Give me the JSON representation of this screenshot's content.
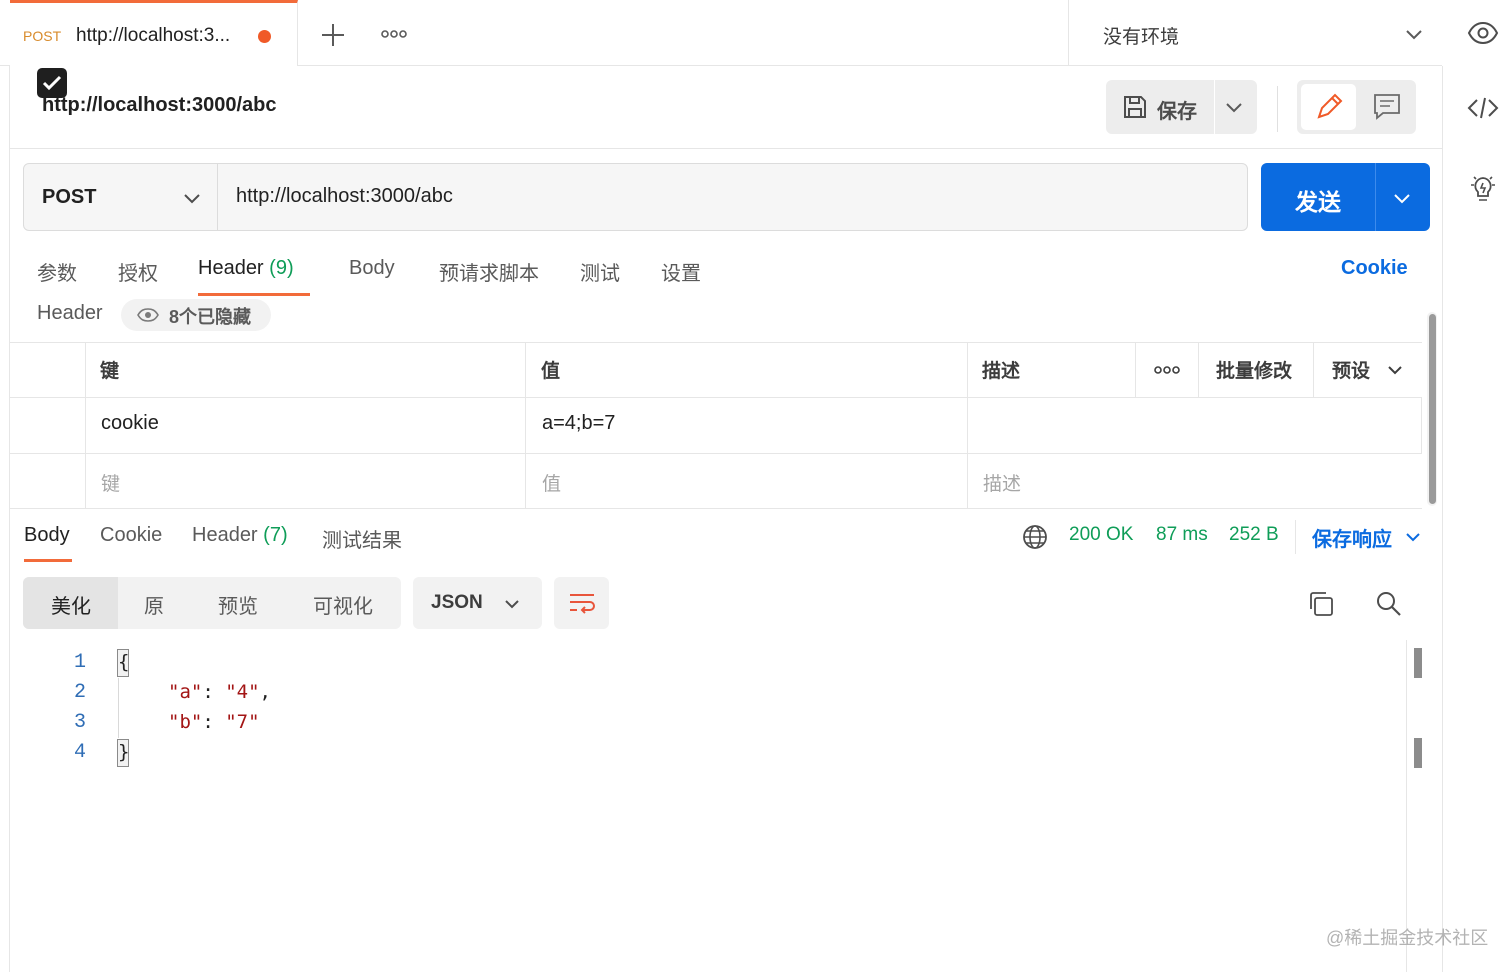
{
  "tab": {
    "method": "POST",
    "title": "http://localhost:3...",
    "unsaved_color": "#f05a28"
  },
  "environment": {
    "label": "没有环境"
  },
  "request": {
    "title": "http://localhost:3000/abc",
    "save_label": "保存",
    "method": "POST",
    "url": "http://localhost:3000/abc",
    "send_label": "发送"
  },
  "request_tabs": [
    {
      "label": "参数"
    },
    {
      "label": "授权"
    },
    {
      "label": "Header",
      "count": "(9)"
    },
    {
      "label": "Body"
    },
    {
      "label": "预请求脚本"
    },
    {
      "label": "测试"
    },
    {
      "label": "设置"
    }
  ],
  "cookie_link": "Cookie",
  "headers_section": {
    "label": "Header",
    "hidden_label": "8个已隐藏",
    "columns": {
      "key": "键",
      "value": "值",
      "description": "描述",
      "bulk_edit": "批量修改",
      "presets": "预设"
    },
    "rows": [
      {
        "checked": true,
        "key": "cookie",
        "value": "a=4;b=7",
        "description": ""
      }
    ],
    "placeholders": {
      "key": "键",
      "value": "值",
      "description": "描述"
    }
  },
  "response_tabs": [
    {
      "label": "Body"
    },
    {
      "label": "Cookie"
    },
    {
      "label": "Header",
      "count": "(7)"
    },
    {
      "label": "测试结果"
    }
  ],
  "response_status": {
    "status": "200 OK",
    "time": "87 ms",
    "size": "252 B",
    "save_response_label": "保存响应"
  },
  "format_modes": [
    "美化",
    "原",
    "预览",
    "可视化"
  ],
  "format_language": "JSON",
  "response_body": {
    "line_numbers": [
      "1",
      "2",
      "3",
      "4"
    ],
    "open_brace": "{",
    "lines": [
      {
        "key": "\"a\"",
        "value": "\"4\"",
        "trailing": ","
      },
      {
        "key": "\"b\"",
        "value": "\"7\"",
        "trailing": ""
      }
    ],
    "close_brace": "}"
  },
  "colors": {
    "accent_orange": "#f26b3a",
    "primary_blue": "#0b6be0",
    "success_green": "#0f9d58",
    "string_red": "#a31515"
  },
  "icons": [
    "plus-icon",
    "more-icon",
    "chevron-down-icon",
    "eye-icon",
    "code-icon",
    "bulb-icon",
    "save-icon",
    "pencil-icon",
    "comment-icon",
    "globe-icon",
    "wrap-icon",
    "copy-icon",
    "search-icon"
  ],
  "watermark": "@稀土掘金技术社区"
}
